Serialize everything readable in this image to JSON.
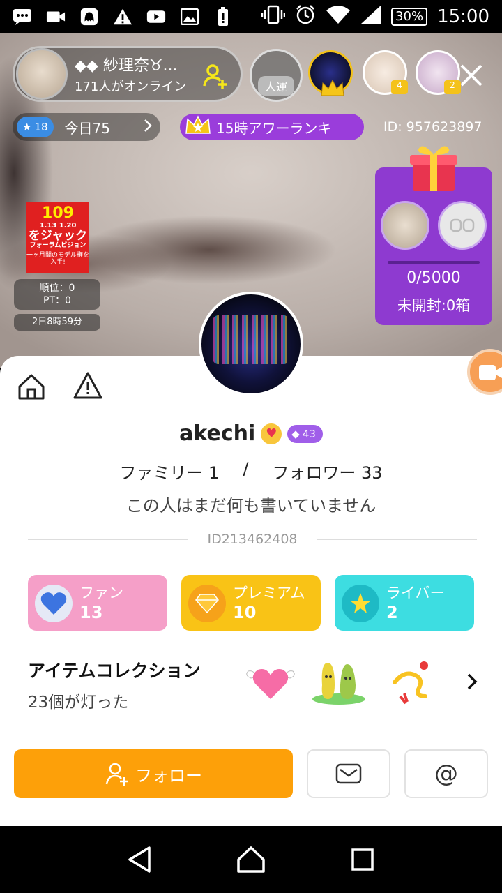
{
  "status_bar": {
    "battery": "30%",
    "time": "15:00"
  },
  "live": {
    "host": {
      "name": "◆◆ 紗理奈♉︎...",
      "online": "171人がオンライン"
    },
    "luck_label": "人運",
    "viewer_badges": [
      "4",
      "2"
    ],
    "today": {
      "star_level": "18",
      "label": "今日75"
    },
    "ranking": "15時アワーランキ",
    "live_id": "ID: 957623897",
    "event": {
      "banner_top": "109",
      "banner_dates": "1.13 1.20",
      "banner_main": "をジャック",
      "banner_sub": "フォーラムビジョン",
      "banner_note": "一ヶ月間のモデル権を入手!",
      "rank": "順位：0",
      "pt": "PT：0",
      "timer": "2日8時59分"
    },
    "gift_box": {
      "progress": "0/5000",
      "unopened": "未開封:0箱"
    }
  },
  "profile": {
    "username": "akechi",
    "gem_level": "43",
    "family": "ファミリー 1",
    "separator": "/",
    "followers": "フォロワー 33",
    "bio": "この人はまだ何も書いていません",
    "user_id": "ID213462408",
    "cards": [
      {
        "label": "ファン",
        "count": "13",
        "icon": "blue-heart-icon"
      },
      {
        "label": "プレミアム",
        "count": "10",
        "icon": "diamond-icon"
      },
      {
        "label": "ライバー",
        "count": "2",
        "icon": "star-icon"
      }
    ],
    "items": {
      "title": "アイテムコレクション",
      "count": "23個が灯った"
    },
    "follow_label": "フォロー",
    "mention_label": "@"
  },
  "colors": {
    "accent_orange": "#fda009",
    "purple": "#9a3ddb",
    "fan_pink": "#f59fc8",
    "premium_yellow": "#f9c316",
    "liver_cyan": "#3ddde1"
  }
}
